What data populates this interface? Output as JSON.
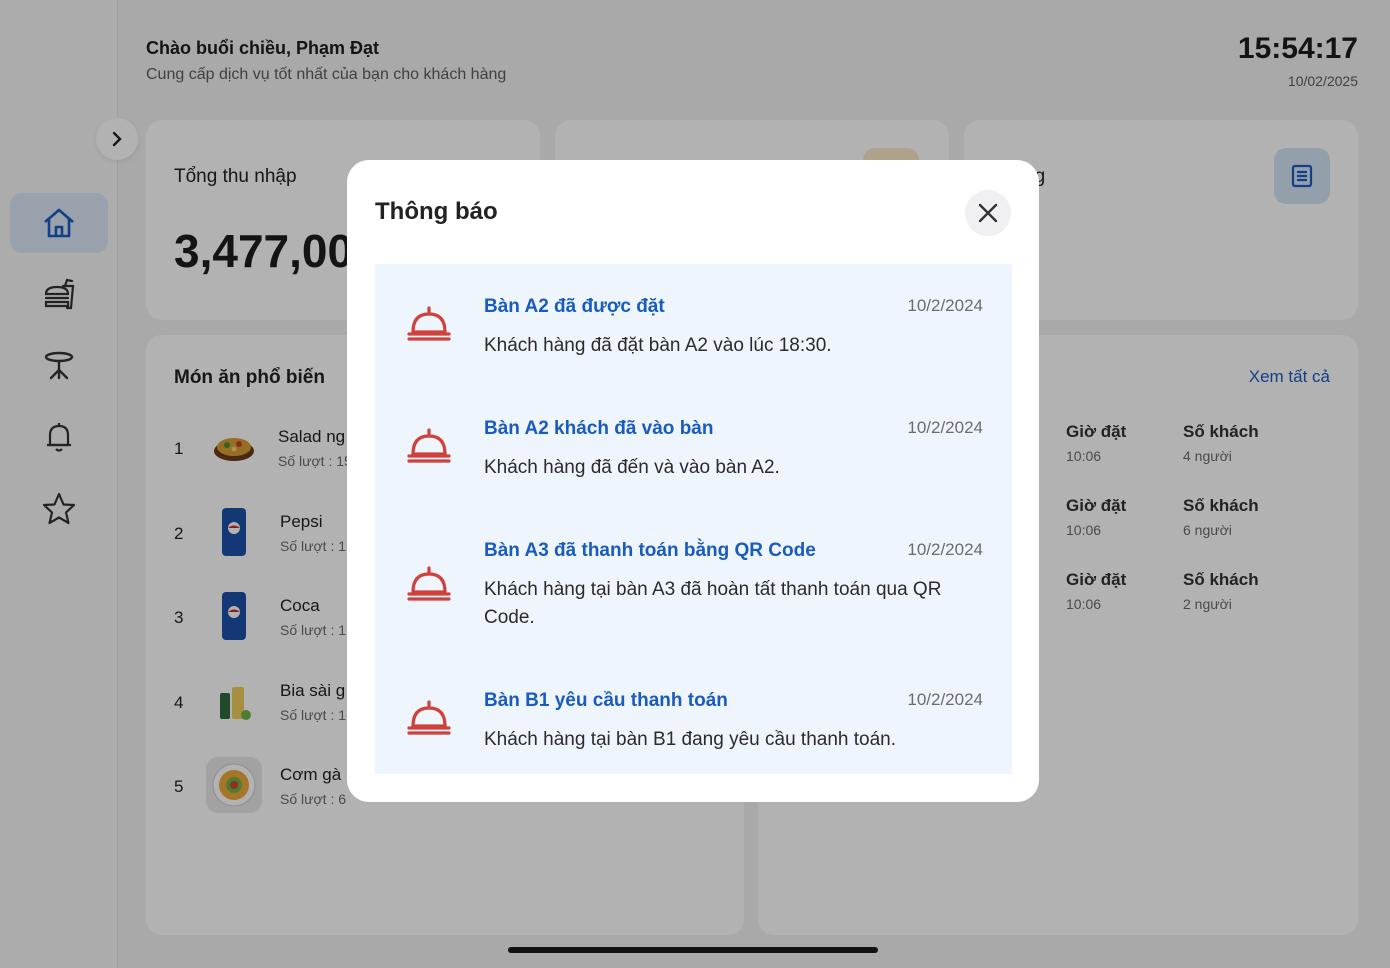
{
  "header": {
    "greeting": "Chào buổi chiều, Phạm Đạt",
    "subtitle": "Cung cấp dịch vụ tốt nhất của bạn cho khách hàng",
    "time": "15:54:17",
    "date": "10/02/2025"
  },
  "sidebar": {
    "items": [
      {
        "icon": "home-icon",
        "active": true
      },
      {
        "icon": "burger-drink-icon",
        "active": false
      },
      {
        "icon": "table-icon",
        "active": false
      },
      {
        "icon": "bell-icon",
        "active": false
      },
      {
        "icon": "star-icon",
        "active": false
      }
    ]
  },
  "stats": {
    "income_label": "Tổng thu nhập",
    "income_value": "3,477,00",
    "orders_label_partial": "ng"
  },
  "popular": {
    "title": "Món ăn phổ biến",
    "items": [
      {
        "rank": "1",
        "name": "Salad ng",
        "count": "Số lượt : 15"
      },
      {
        "rank": "2",
        "name": "Pepsi",
        "count": "Số lượt : 1"
      },
      {
        "rank": "3",
        "name": "Coca",
        "count": "Số lượt : 1"
      },
      {
        "rank": "4",
        "name": "Bia sài g",
        "count": "Số lượt : 1"
      },
      {
        "rank": "5",
        "name": "Cơm gà",
        "count": "Số lượt : 6"
      }
    ]
  },
  "reservations": {
    "see_all": "Xem tất cả",
    "time_label": "Giờ đặt",
    "guests_label": "Số khách",
    "rows": [
      {
        "time": "10:06",
        "guests": "4 người"
      },
      {
        "time": "10:06",
        "guests": "6 người"
      },
      {
        "time": "10:06",
        "guests": "2 người"
      }
    ]
  },
  "modal": {
    "title": "Thông báo",
    "notifications": [
      {
        "title": "Bàn A2 đã được đặt",
        "date": "10/2/2024",
        "body": "Khách hàng đã đặt bàn A2 vào lúc 18:30."
      },
      {
        "title": "Bàn A2 khách đã vào bàn",
        "date": "10/2/2024",
        "body": "Khách hàng đã đến và vào bàn A2."
      },
      {
        "title": "Bàn A3 đã thanh toán bằng QR Code",
        "date": "10/2/2024",
        "body": "Khách hàng tại bàn A3 đã hoàn tất thanh toán qua QR Code."
      },
      {
        "title": "Bàn B1 yêu cầu thanh toán",
        "date": "10/2/2024",
        "body": "Khách hàng tại bàn B1 đang yêu cầu thanh toán."
      }
    ]
  },
  "colors": {
    "accent": "#1a5bbf",
    "notification_icon": "#d0413b",
    "notification_bg": "#eef5fc"
  }
}
